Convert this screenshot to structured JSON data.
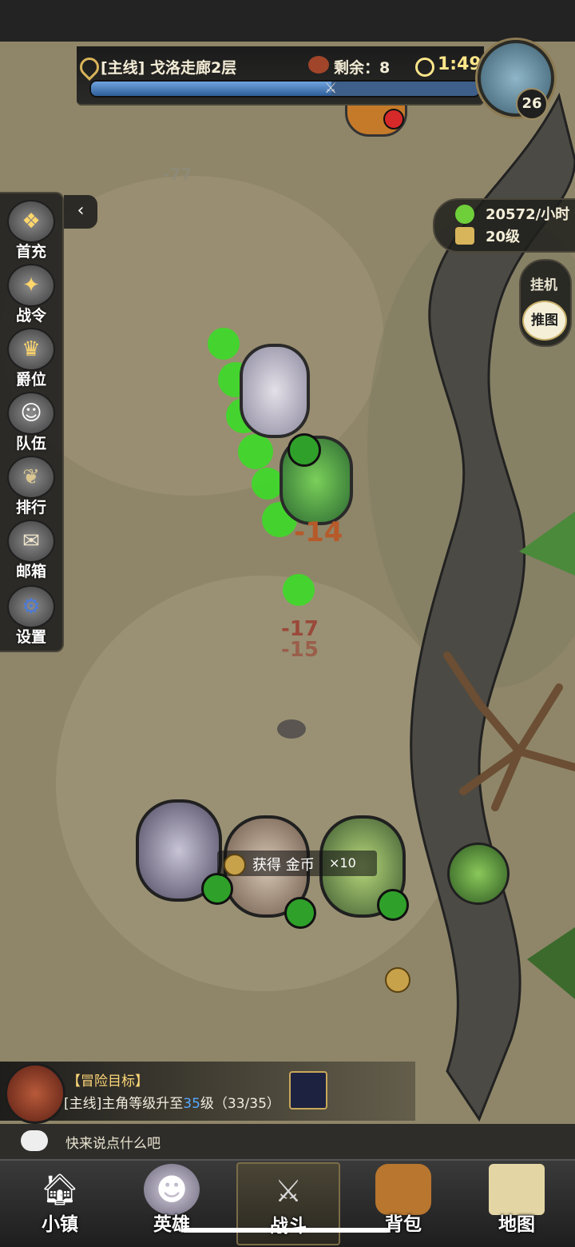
{
  "stage": {
    "title": "[主线] 戈洛走廊2层",
    "remaining_label": "剩余：8",
    "timer": "1:49",
    "progress": 0.62
  },
  "player": {
    "level": "26"
  },
  "side_menu": [
    {
      "id": "first-recharge",
      "label": "首充",
      "icon": "treasure-chest-icon"
    },
    {
      "id": "battle-pass",
      "label": "战令",
      "icon": "crest-icon"
    },
    {
      "id": "rank-title",
      "label": "爵位",
      "icon": "crown-icon"
    },
    {
      "id": "team",
      "label": "队伍",
      "icon": "team-faces-icon"
    },
    {
      "id": "leaderboard",
      "label": "排行",
      "icon": "laurel-icon"
    },
    {
      "id": "mailbox",
      "label": "邮箱",
      "icon": "envelope-icon"
    },
    {
      "id": "settings",
      "label": "设置",
      "icon": "gear-icon"
    }
  ],
  "income": {
    "rate": "20572/小时",
    "level": "20级"
  },
  "mode": {
    "idle": "挂机",
    "push": "推图"
  },
  "damage_numbers": [
    "-77",
    "-14",
    "-17",
    "-15"
  ],
  "loot": {
    "text": "获得 金币",
    "count": "×10"
  },
  "goal": {
    "title": "【冒险目标】",
    "desc_prefix": "[主线]主角等级升至",
    "desc_level": "35",
    "desc_suffix": "级（33/35）"
  },
  "chat": {
    "placeholder": "快来说点什么吧"
  },
  "bottom_nav": [
    {
      "id": "town",
      "label": "小镇",
      "icon": "house-icon",
      "active": false
    },
    {
      "id": "heroes",
      "label": "英雄",
      "icon": "hero-portrait-icon",
      "active": false
    },
    {
      "id": "battle",
      "label": "战斗",
      "icon": "crossed-swords-icon",
      "active": true
    },
    {
      "id": "bag",
      "label": "背包",
      "icon": "backpack-icon",
      "active": false
    },
    {
      "id": "map",
      "label": "地图",
      "icon": "scroll-map-icon",
      "active": false
    }
  ],
  "colors": {
    "accent_gold": "#ffd87a",
    "progress_blue": "#3d5f8a",
    "poison_green": "#3cdc28"
  }
}
